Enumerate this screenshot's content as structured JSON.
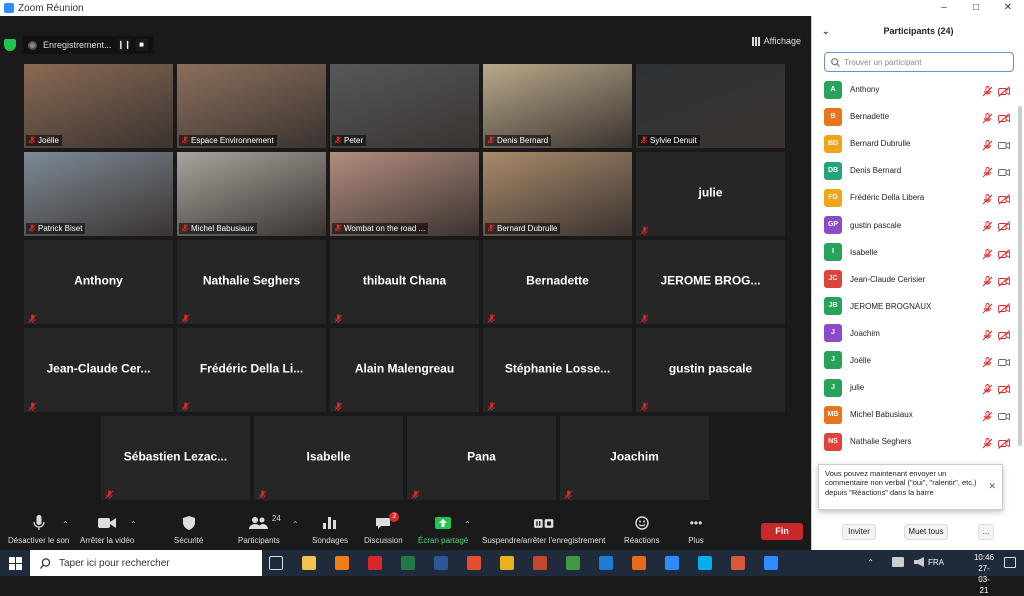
{
  "window": {
    "title": "Zoom Réunion"
  },
  "recording": {
    "label": "Enregistrement..."
  },
  "view_button": {
    "label": "Affichage"
  },
  "video_tiles": [
    {
      "name": "Joëlle",
      "bg": "#8a6a54"
    },
    {
      "name": "Espace Environnement",
      "bg": "#8b6f5c",
      "active": true
    },
    {
      "name": "Peter",
      "bg": "#55585a"
    },
    {
      "name": "Denis Bernard",
      "bg": "#b9a98a"
    },
    {
      "name": "Sylvie Denuit",
      "bg": "#2e3234"
    },
    {
      "name": "Patrick Biset",
      "bg": "#7d8a96"
    },
    {
      "name": "Michel Babusiaux",
      "bg": "#a8a39c"
    },
    {
      "name": "Wombat on the road ...",
      "bg": "#b38d7f"
    },
    {
      "name": "Bernard Dubrulle",
      "bg": "#a98a6b"
    }
  ],
  "name_tiles": [
    "julie",
    "Anthony",
    "Nathalie Seghers",
    "thibault Chana",
    "Bernadette",
    "JEROME  BROG...",
    "Jean-Claude  Cer...",
    "Frédéric  Della  Li...",
    "Alain Malengreau",
    "Stéphanie  Losse...",
    "gustin pascale",
    "Sébastien  Lezac...",
    "Isabelle",
    "Pana",
    "Joachim"
  ],
  "toolbar": {
    "mute": "Désactiver le son",
    "video": "Arrêter la vidéo",
    "security": "Sécurité",
    "participants": "Participants",
    "participants_count": "24",
    "polls": "Sondages",
    "chat": "Discussion",
    "chat_badge": "2",
    "share": "Écran partagé",
    "record": "Suspendre/arrêter l'enregistrement",
    "reactions": "Réactions",
    "more": "Plus",
    "end": "Fin"
  },
  "panel": {
    "title": "Participants (24)",
    "search_placeholder": "Trouver un participant",
    "participants": [
      {
        "initials": "A",
        "name": "Anthony",
        "color": "#27a35a",
        "video_on": false
      },
      {
        "initials": "B",
        "name": "Bernadette",
        "color": "#e8741c",
        "video_on": false
      },
      {
        "initials": "BD",
        "name": "Bernard Dubrulle",
        "color": "#f2a31c",
        "video_on": true
      },
      {
        "initials": "DB",
        "name": "Denis Bernard",
        "color": "#27a37a",
        "video_on": true
      },
      {
        "initials": "FD",
        "name": "Frédéric Della Libera",
        "color": "#f2a31c",
        "video_on": false
      },
      {
        "initials": "GP",
        "name": "gustin pascale",
        "color": "#8e4bc9",
        "video_on": false
      },
      {
        "initials": "I",
        "name": "Isabelle",
        "color": "#27a35a",
        "video_on": false
      },
      {
        "initials": "JC",
        "name": "Jean-Claude Cerisier",
        "color": "#e0433a",
        "video_on": false
      },
      {
        "initials": "JB",
        "name": "JEROME BROGNAUX",
        "color": "#27a35a",
        "video_on": false
      },
      {
        "initials": "J",
        "name": "Joachim",
        "color": "#8e4bc9",
        "video_on": false
      },
      {
        "initials": "J",
        "name": "Joëlle",
        "color": "#27a35a",
        "video_on": true
      },
      {
        "initials": "J",
        "name": "julie",
        "color": "#27a35a",
        "video_on": false
      },
      {
        "initials": "MB",
        "name": "Michel Babusiaux",
        "color": "#e8741c",
        "video_on": true
      },
      {
        "initials": "NS",
        "name": "Nathalie Seghers",
        "color": "#e0433a",
        "video_on": false
      }
    ],
    "toast": "Vous pouvez maintenant envoyer un commentaire non verbal (\"oui\", \"ralentir\", etc.) depuis \"Réactions\" dans la barre",
    "invite": "Inviter",
    "mute_all": "Muet tous",
    "more": "..."
  },
  "taskbar": {
    "search_placeholder": "Taper ici pour rechercher",
    "lang": "FRA",
    "time": "10:46",
    "date": "27-03-21"
  },
  "colors": {
    "accent_green": "#4fd274",
    "end_red": "#c8272c",
    "mute_red": "#e02828",
    "active_speaker": "#d8e64a"
  }
}
